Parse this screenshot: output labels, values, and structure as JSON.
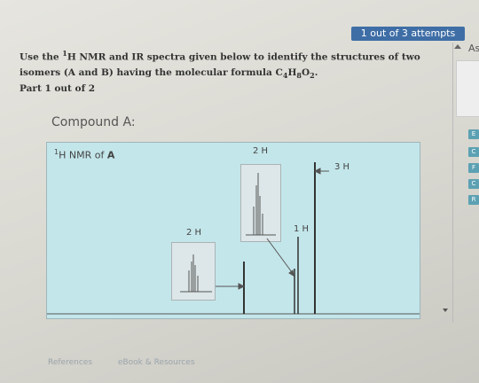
{
  "attempts": "1 out of 3 attempts",
  "question": {
    "prefix": "Use the ",
    "nucleus_sup": "1",
    "mid": "H NMR and IR spectra given below to identify the structures of two isomers (A and B) having the molecular formula C",
    "s4": "4",
    "h": "H",
    "s8": "8",
    "o": "O",
    "s2": "2",
    "end": "."
  },
  "part": "Part 1 out of 2",
  "compound": "Compound A:",
  "spectrum": {
    "title_sup": "1",
    "title_text": "H NMR of ",
    "title_bold": "A",
    "labels": {
      "peak1": "2 H",
      "peak2": "2 H",
      "peak3": "1 H",
      "peak4": "3 H"
    }
  },
  "side": {
    "top_label": "As",
    "buttons": [
      "E",
      "C",
      "F",
      "C",
      "R"
    ]
  },
  "footer": {
    "references": "References",
    "ebook": "eBook & Resources"
  },
  "colors": {
    "attempts_bg": "#3f6ea6",
    "spectrum_bg": "#c3e6ea",
    "side_btn": "#5ca1b3"
  }
}
